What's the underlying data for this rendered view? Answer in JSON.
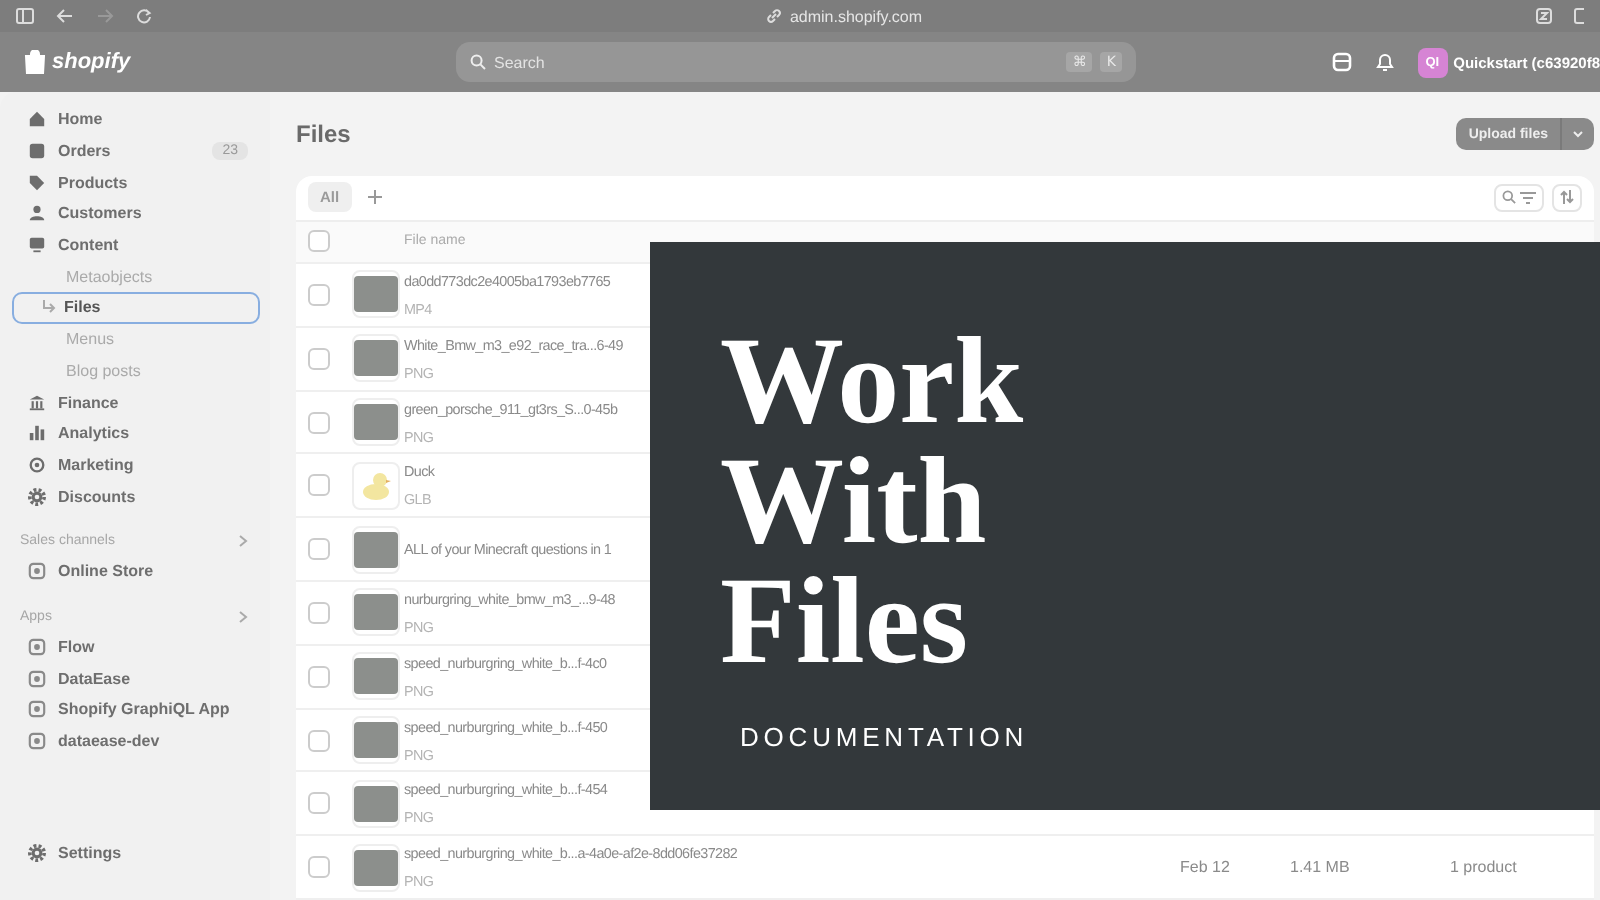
{
  "browser": {
    "url": "admin.shopify.com"
  },
  "header": {
    "logo": "shopify",
    "search": {
      "placeholder": "Search",
      "keys": [
        "⌘",
        "K"
      ]
    },
    "avatar": "QI",
    "store": "Quickstart (c63920f8"
  },
  "nav": {
    "items": [
      {
        "label": "Home",
        "kind": "item",
        "selected": false
      },
      {
        "label": "Orders",
        "kind": "item",
        "badge": "23",
        "selected": false
      },
      {
        "label": "Products",
        "kind": "item",
        "selected": false
      },
      {
        "label": "Customers",
        "kind": "item",
        "selected": false
      },
      {
        "label": "Content",
        "kind": "item",
        "selected": false
      },
      {
        "label": "Metaobjects",
        "kind": "sub",
        "selected": false
      },
      {
        "label": "Files",
        "kind": "sub",
        "selected": true
      },
      {
        "label": "Menus",
        "kind": "sub",
        "selected": false
      },
      {
        "label": "Blog posts",
        "kind": "sub",
        "selected": false
      },
      {
        "label": "Finance",
        "kind": "item",
        "selected": false
      },
      {
        "label": "Analytics",
        "kind": "item",
        "selected": false
      },
      {
        "label": "Marketing",
        "kind": "item",
        "selected": false
      },
      {
        "label": "Discounts",
        "kind": "item",
        "selected": false
      }
    ],
    "sections": [
      {
        "title": "Sales channels",
        "items": [
          {
            "label": "Online Store",
            "selected": false
          }
        ]
      },
      {
        "title": "Apps",
        "items": [
          {
            "label": "Flow",
            "selected": false
          },
          {
            "label": "DataEase",
            "selected": false
          },
          {
            "label": "Shopify GraphiQL App",
            "selected": false
          },
          {
            "label": "dataease-dev",
            "selected": false
          }
        ]
      }
    ],
    "settings": "Settings"
  },
  "page": {
    "title": "Files",
    "upload_button": "Upload files"
  },
  "tabs": [
    {
      "label": "All",
      "selected": true
    }
  ],
  "table": {
    "columns": [
      "File name"
    ],
    "select_all_checked": false,
    "rows": [
      {
        "name": "da0dd773dc2e4005ba1793eb7765",
        "type": "MP4",
        "kind": "photo",
        "checked": false
      },
      {
        "name": "White_Bmw_m3_e92_race_tra...6-49",
        "type": "PNG",
        "kind": "photo",
        "checked": false
      },
      {
        "name": "green_porsche_911_gt3rs_S...0-45b",
        "type": "PNG",
        "kind": "photo",
        "checked": false
      },
      {
        "name": "Duck",
        "type": "GLB",
        "kind": "model",
        "checked": false
      },
      {
        "name": "ALL of your Minecraft questions in 1",
        "kind": "photo",
        "checked": false
      },
      {
        "name": "nurburgring_white_bmw_m3_...9-48",
        "type": "PNG",
        "kind": "photo",
        "checked": false
      },
      {
        "name": "speed_nurburgring_white_b...f-4c0",
        "type": "PNG",
        "kind": "photo",
        "checked": false
      },
      {
        "name": "speed_nurburgring_white_b...f-450",
        "type": "PNG",
        "kind": "photo",
        "checked": false
      },
      {
        "name": "speed_nurburgring_white_b...f-454",
        "type": "PNG",
        "kind": "photo",
        "checked": false
      },
      {
        "name": "speed_nurburgring_white_b...a-4a0e-af2e-8dd06fe37282",
        "type": "PNG",
        "kind": "photo",
        "checked": false,
        "date": "Feb 12",
        "size": "1.41 MB",
        "references": "1 product"
      }
    ]
  },
  "overlay": {
    "title": "Work With Files",
    "subtitle": "DOCUMENTATION"
  }
}
